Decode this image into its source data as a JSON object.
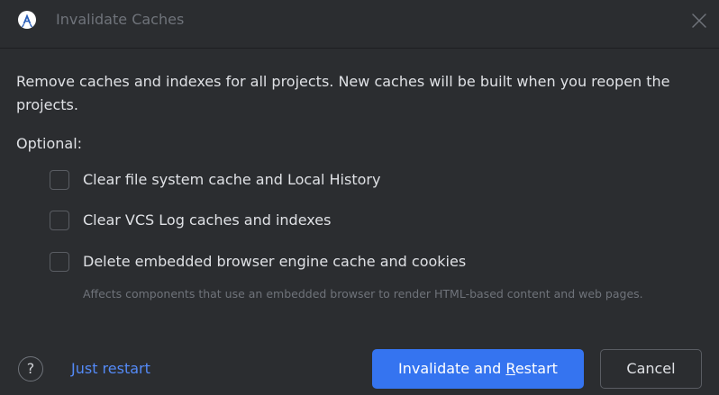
{
  "window": {
    "title": "Invalidate Caches",
    "app_icon": "android-studio-icon",
    "close_icon": "close-icon"
  },
  "description": "Remove caches and indexes for all projects. New caches will be built when you reopen the projects.",
  "optional_label": "Optional:",
  "options": [
    {
      "label": "Clear file system cache and Local History",
      "checked": false
    },
    {
      "label": "Clear VCS Log caches and indexes",
      "checked": false
    },
    {
      "label": "Delete embedded browser engine cache and cookies",
      "checked": false
    }
  ],
  "hint": "Affects components that use an embedded browser to render HTML-based content and web pages.",
  "footer": {
    "help_label": "?",
    "just_restart_label": "Just restart",
    "primary_label_pre": "Invalidate and ",
    "primary_label_mnemonic": "R",
    "primary_label_post": "estart",
    "cancel_label": "Cancel"
  },
  "colors": {
    "background": "#2b2d30",
    "text": "#dfe1e5",
    "muted": "#6f737a",
    "link": "#548af7",
    "primary": "#3574f0"
  }
}
